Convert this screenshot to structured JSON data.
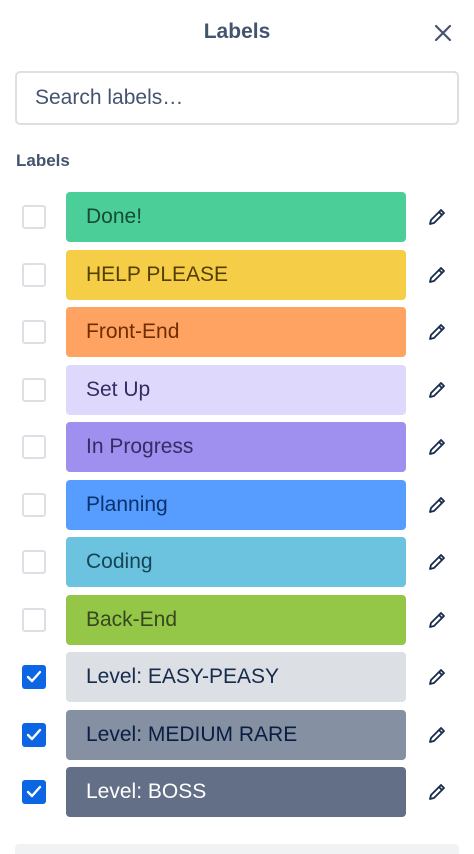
{
  "header": {
    "title": "Labels"
  },
  "search": {
    "placeholder": "Search labels…",
    "value": ""
  },
  "section": {
    "heading": "Labels"
  },
  "labels": [
    {
      "name": "Done!",
      "checked": false,
      "bg": "#4bce97",
      "fg": "#164b35"
    },
    {
      "name": "HELP PLEASE",
      "checked": false,
      "bg": "#f5cd47",
      "fg": "#533f04"
    },
    {
      "name": "Front-End",
      "checked": false,
      "bg": "#fea362",
      "fg": "#702e00"
    },
    {
      "name": "Set Up",
      "checked": false,
      "bg": "#dfd8fd",
      "fg": "#352c63"
    },
    {
      "name": "In Progress",
      "checked": false,
      "bg": "#9f8fef",
      "fg": "#352c63"
    },
    {
      "name": "Planning",
      "checked": false,
      "bg": "#579dff",
      "fg": "#09326c"
    },
    {
      "name": "Coding",
      "checked": false,
      "bg": "#6cc3e0",
      "fg": "#164555"
    },
    {
      "name": "Back-End",
      "checked": false,
      "bg": "#94c748",
      "fg": "#37471f"
    },
    {
      "name": "Level: EASY-PEASY",
      "checked": true,
      "bg": "#dcdfe4",
      "fg": "#172b4d"
    },
    {
      "name": "Level: MEDIUM RARE",
      "checked": true,
      "bg": "#8590a2",
      "fg": "#091e42"
    },
    {
      "name": "Level: BOSS",
      "checked": true,
      "bg": "#626f86",
      "fg": "#ffffff"
    }
  ],
  "icons": {
    "close": "close-icon",
    "edit": "pencil-icon",
    "check": "checkmark-icon"
  },
  "colors": {
    "accent": "#0c66e4",
    "text": "#44546f",
    "border": "#dcdfe4"
  }
}
